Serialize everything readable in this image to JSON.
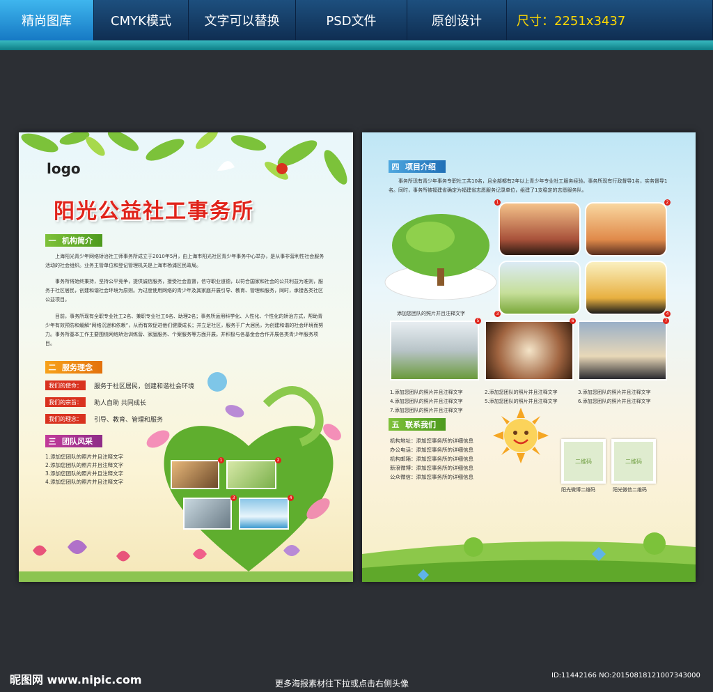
{
  "topbar": {
    "tabs": [
      "精尚图库",
      "CMYK模式",
      "文字可以替换",
      "PSD文件",
      "原创设计"
    ],
    "size": "尺寸：2251x3437"
  },
  "page1": {
    "logo": "logo",
    "title": "阳光公益社工事务所",
    "sec1": {
      "num": "一",
      "label": "机构简介"
    },
    "paras": [
      "上海阳光青少年网络矫治社工师事务所成立于2010年5月，由上海市阳光社区青少年事务中心举办，是从事非营利性社会服务活动的社会组织。业务主管单位和登记管理机关是上海市杨浦区民政局。",
      "事务所将始终秉持，坚持公平竞争，提供诚信服务，接受社会监督，信守职业道德，以符合国家和社会的公共利益为准则，服务于社区居民，创建和谐社会环境为原则。为过度使用网络的青少年及其家庭开展引导、教育、管理和服务，同时，承接各类社区公益项目。",
      "目前，事务所现有全职专业社工2名、兼职专业社工6名、助理2名；事务所运用科学化、人性化、个性化的矫治方式，帮助青少年有效预防和缓解“网络沉迷和依赖”，从而有效促进他们健康成长；并立足社区，服务于广大居民，为创建和谐的社会环境而努力。事务所基本工作主要围绕网络矫治训练营、家庭服务、个案服务等方面开展。并积极与各基金会合作开展各类青少年服务项目。"
    ],
    "sec2": {
      "num": "二",
      "label": "服务理念"
    },
    "tags": [
      {
        "label": "我们的使命：",
        "text": "服务于社区居民，创建和谐社会环境"
      },
      {
        "label": "我们的宗旨：",
        "text": "助人自助  共同成长"
      },
      {
        "label": "我们的理念：",
        "text": "引导、教育、管理和服务"
      }
    ],
    "sec3": {
      "num": "三",
      "label": "团队风采"
    },
    "list": [
      "1.添加您团队的照片并且注释文字",
      "2.添加您团队的照片并且注释文字",
      "3.添加您团队的照片并且注释文字",
      "4.添加您团队的照片并且注释文字"
    ],
    "photo_nums": [
      "1",
      "2",
      "3",
      "4"
    ]
  },
  "page2": {
    "sec4": {
      "num": "四",
      "label": "项目介绍"
    },
    "intro": "事务所现有青少年事务专职社工共10名，且全部都有2年以上青少年专业社工服务经验。事务所现有行政督导1名，实务督导1名。同时，事务所被福建省确定为福建省志愿服务记录单位，组建了1支稳定的志愿服务队。",
    "tree_caption": "添加您团队的照片并且注释文字",
    "photo_nums": [
      "1",
      "2",
      "3",
      "4",
      "5",
      "6",
      "7"
    ],
    "captions": [
      "1.添加您团队的照片并且注释文字",
      "2.添加您团队的照片并且注释文字",
      "3.添加您团队的照片并且注释文字",
      "4.添加您团队的照片并且注释文字",
      "5.添加您团队的照片并且注释文字",
      "6.添加您团队的照片并且注释文字",
      "7.添加您团队的照片并且注释文字"
    ],
    "sec5": {
      "num": "五",
      "label": "联系我们"
    },
    "contacts": [
      "机构地址：添加您事务所的详细信息",
      "办公电话：添加您事务所的详细信息",
      "机构邮箱：添加您事务所的详细信息",
      "新浪微博：添加您事务所的详细信息",
      "公众微信：添加您事务所的详细信息"
    ],
    "qr": [
      {
        "label": "二维码",
        "caption": "阳光微博二维码"
      },
      {
        "label": "二维码",
        "caption": "阳光微信二维码"
      }
    ]
  },
  "footer": {
    "site": "昵图网 www.nipic.com",
    "middle": "更多海报素材往下拉或点击右侧头像",
    "id": "ID:11442166 NO:20150818121007343000"
  }
}
